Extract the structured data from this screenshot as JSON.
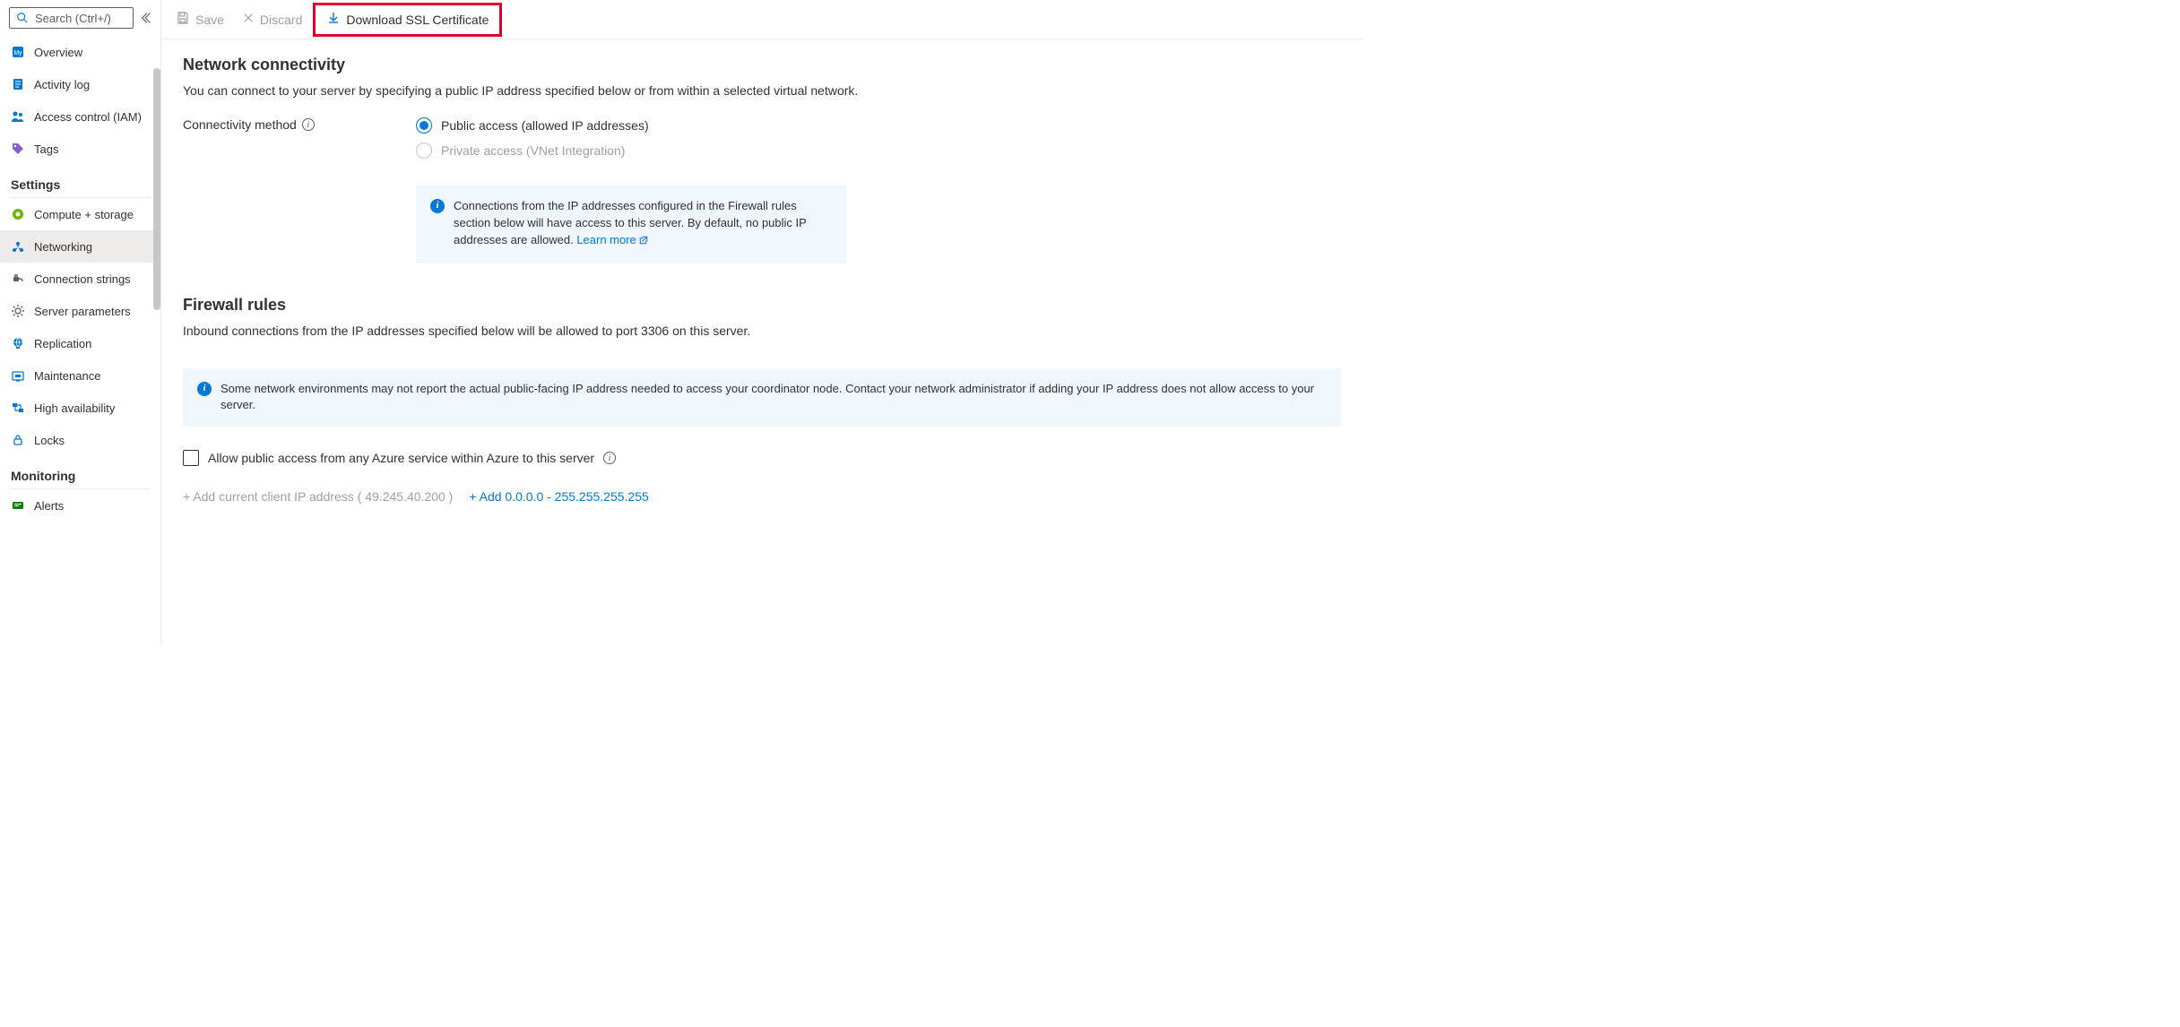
{
  "sidebar": {
    "search_placeholder": "Search (Ctrl+/)",
    "top": [
      {
        "label": "Overview",
        "icon": "mysql"
      },
      {
        "label": "Activity log",
        "icon": "log"
      },
      {
        "label": "Access control (IAM)",
        "icon": "people"
      },
      {
        "label": "Tags",
        "icon": "tag"
      }
    ],
    "group_settings": "Settings",
    "settings": [
      {
        "label": "Compute + storage",
        "icon": "compute"
      },
      {
        "label": "Networking",
        "icon": "network",
        "selected": true
      },
      {
        "label": "Connection strings",
        "icon": "plug"
      },
      {
        "label": "Server parameters",
        "icon": "gear"
      },
      {
        "label": "Replication",
        "icon": "globe"
      },
      {
        "label": "Maintenance",
        "icon": "maintenance"
      },
      {
        "label": "High availability",
        "icon": "ha"
      },
      {
        "label": "Locks",
        "icon": "lock"
      }
    ],
    "group_monitoring": "Monitoring",
    "monitoring": [
      {
        "label": "Alerts",
        "icon": "alert"
      }
    ]
  },
  "toolbar": {
    "save": "Save",
    "discard": "Discard",
    "download": "Download SSL Certificate"
  },
  "main": {
    "net_title": "Network connectivity",
    "net_desc": "You can connect to your server by specifying a public IP address specified below or from within a selected virtual network.",
    "conn_label": "Connectivity method",
    "radio_public": "Public access (allowed IP addresses)",
    "radio_private": "Private access (VNet Integration)",
    "info1_text": "Connections from the IP addresses configured in the Firewall rules section below will have access to this server. By default, no public IP addresses are allowed. ",
    "info1_link": "Learn more",
    "fw_title": "Firewall rules",
    "fw_desc": "Inbound connections from the IP addresses specified below will be allowed to port 3306 on this server.",
    "info2_text": "Some network environments may not report the actual public-facing IP address needed to access your coordinator node. Contact your network administrator if adding your IP address does not allow access to your server.",
    "allow_azure": "Allow public access from any Azure service within Azure to this server",
    "add_client": "+ Add current client IP address ( 49.245.40.200 )",
    "add_range": "+ Add 0.0.0.0 - 255.255.255.255"
  }
}
